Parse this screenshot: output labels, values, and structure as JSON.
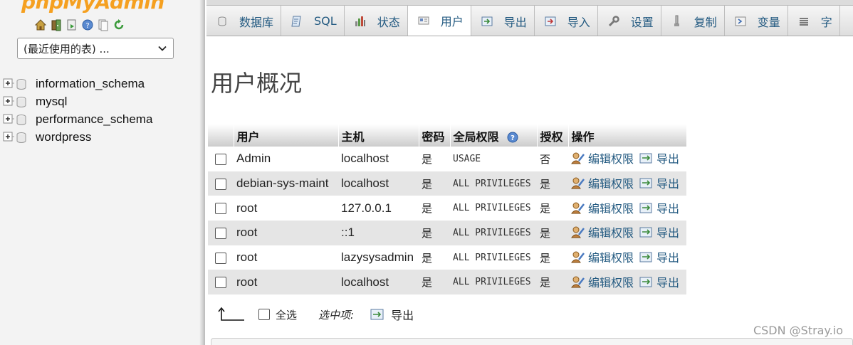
{
  "nav": {
    "logo": "phpMyAdmin",
    "icons": [
      "home-icon",
      "exit-icon",
      "query-icon",
      "help-icon",
      "docs-icon",
      "reload-icon"
    ],
    "recent_select": "(最近使用的表) ...",
    "databases": [
      "information_schema",
      "mysql",
      "performance_schema",
      "wordpress"
    ]
  },
  "tabs": [
    {
      "label": "数据库",
      "icon": "database-icon"
    },
    {
      "label": "SQL",
      "icon": "sql-icon"
    },
    {
      "label": "状态",
      "icon": "status-icon"
    },
    {
      "label": "用户",
      "icon": "users-icon",
      "active": true
    },
    {
      "label": "导出",
      "icon": "export-icon"
    },
    {
      "label": "导入",
      "icon": "import-icon"
    },
    {
      "label": "设置",
      "icon": "settings-icon"
    },
    {
      "label": "复制",
      "icon": "replication-icon"
    },
    {
      "label": "变量",
      "icon": "variables-icon"
    },
    {
      "label": "字",
      "icon": "charset-icon"
    }
  ],
  "page": {
    "title": "用户概况"
  },
  "table": {
    "headers": [
      "用户",
      "主机",
      "密码",
      "全局权限",
      "授权",
      "操作"
    ],
    "rows": [
      {
        "user": "Admin",
        "host": "localhost",
        "password": "是",
        "privileges": "USAGE",
        "grant": "否"
      },
      {
        "user": "debian-sys-maint",
        "host": "localhost",
        "password": "是",
        "privileges": "ALL PRIVILEGES",
        "grant": "是"
      },
      {
        "user": "root",
        "host": "127.0.0.1",
        "password": "是",
        "privileges": "ALL PRIVILEGES",
        "grant": "是"
      },
      {
        "user": "root",
        "host": "::1",
        "password": "是",
        "privileges": "ALL PRIVILEGES",
        "grant": "是"
      },
      {
        "user": "root",
        "host": "lazysysadmin",
        "password": "是",
        "privileges": "ALL PRIVILEGES",
        "grant": "是"
      },
      {
        "user": "root",
        "host": "localhost",
        "password": "是",
        "privileges": "ALL PRIVILEGES",
        "grant": "是"
      }
    ],
    "edit_label": "编辑权限",
    "export_label": "导出"
  },
  "bottom": {
    "select_all": "全选",
    "with_selected": "选中项:",
    "export": "导出"
  },
  "watermark": "CSDN @Stray.io",
  "colors": {
    "link": "#235a81",
    "row_alt": "#e5e5e5",
    "logo": "#f5a020"
  }
}
